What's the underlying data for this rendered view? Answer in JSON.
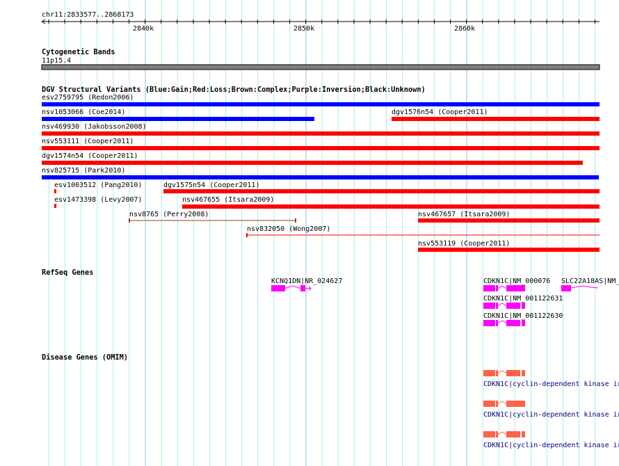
{
  "ruler": {
    "location": "chr11:2833577..2868173",
    "ticks": [
      "2840k",
      "2850k",
      "2860k"
    ]
  },
  "tracks": {
    "cytoband": {
      "title": "Cytogenetic Bands",
      "band": "11p15.4",
      "color": "#808080"
    },
    "dgv": {
      "title": "DGV Structural Variants (Blue:Gain;Red:Loss;Brown:Complex;Purple:Inversion;Black:Unknown)",
      "colors": {
        "gain": "#0000ff",
        "loss": "#ff0000",
        "complex": "#8b4513"
      },
      "features": [
        {
          "label": "esv2759795 (Redon2006)",
          "type": "gain"
        },
        {
          "label": "nsv1053066 (Coe2014)",
          "type": "gain"
        },
        {
          "label": "dgv1576n54 (Cooper2011)",
          "type": "loss"
        },
        {
          "label": "nsv469930 (Jakobsson2008)",
          "type": "loss"
        },
        {
          "label": "nsv553111 (Cooper2011)",
          "type": "loss"
        },
        {
          "label": "dgv1574n54 (Cooper2011)",
          "type": "loss"
        },
        {
          "label": "nsv825715 (Park2010)",
          "type": "gain"
        },
        {
          "label": "esv1003512 (Pang2010)",
          "type": "loss"
        },
        {
          "label": "dgv1575n54 (Cooper2011)",
          "type": "loss"
        },
        {
          "label": "esv1473398 (Levy2007)",
          "type": "loss"
        },
        {
          "label": "nsv467655 (Itsara2009)",
          "type": "loss"
        },
        {
          "label": "nsv8765 (Perry2008)",
          "type": "complex"
        },
        {
          "label": "nsv467657 (Itsara2009)",
          "type": "loss"
        },
        {
          "label": "nsv832050 (Wong2007)",
          "type": "loss"
        },
        {
          "label": "nsv553119 (Cooper2011)",
          "type": "loss"
        }
      ]
    },
    "refseq": {
      "title": "RefSeq Genes",
      "color": "#ff00ff",
      "features": [
        {
          "label": "KCNQ1DN|NR_024627"
        },
        {
          "label": "CDKN1C|NM_000076"
        },
        {
          "label": "SLC22A18AS|NM_"
        },
        {
          "label": "CDKN1C|NM_001122631"
        },
        {
          "label": "CDKN1C|NM_001122630"
        }
      ]
    },
    "omim": {
      "title": "Disease Genes (OMIM)",
      "color": "#ff6347",
      "features": [
        {
          "label": "CDKN1C|cyclin-dependent kinase ir"
        },
        {
          "label": "CDKN1C|cyclin-dependent kinase ir"
        },
        {
          "label": "CDKN1C|cyclin-dependent kinase ir"
        }
      ]
    }
  }
}
